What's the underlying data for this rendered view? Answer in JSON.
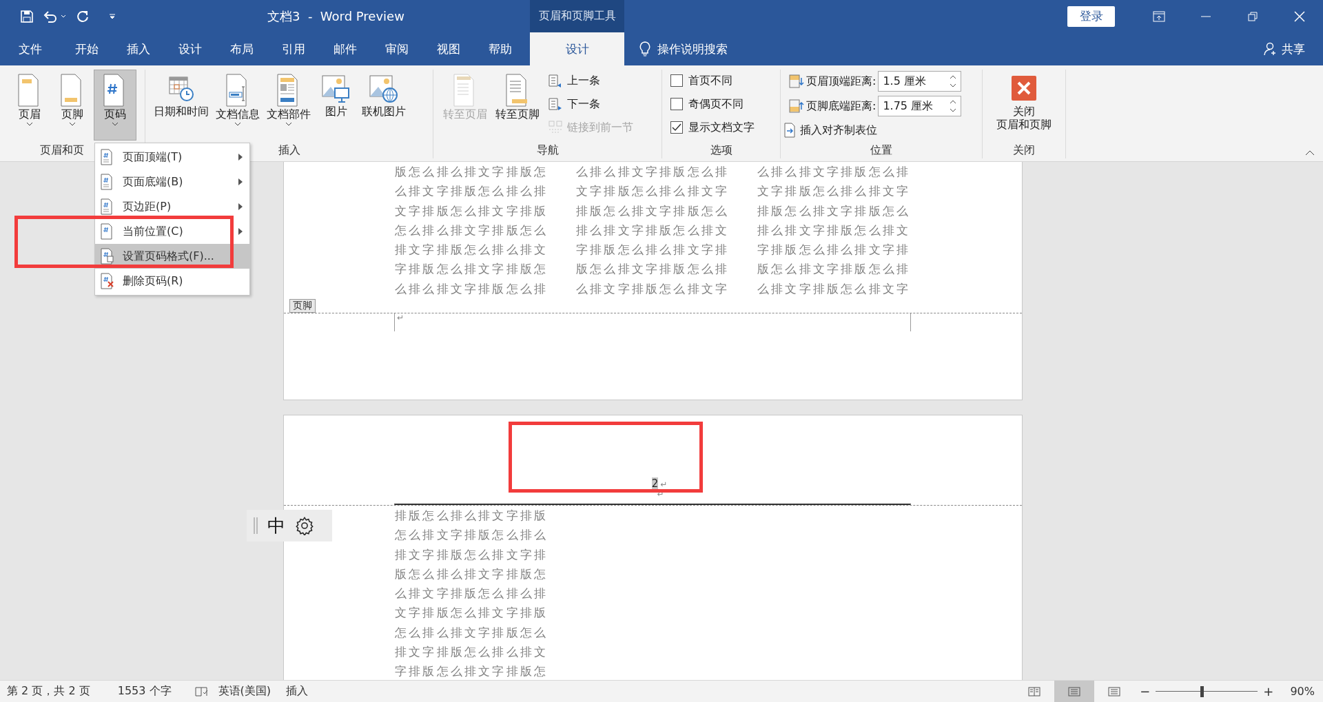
{
  "title_bar": {
    "title": "文档3  -  Word Preview",
    "context_group": "页眉和页脚工具",
    "sign_in": "登录"
  },
  "tabs": [
    {
      "label": "文件",
      "kind": "main",
      "selected": false
    },
    {
      "label": "开始",
      "kind": "main",
      "selected": false
    },
    {
      "label": "插入",
      "kind": "main",
      "selected": false
    },
    {
      "label": "设计",
      "kind": "main",
      "selected": false
    },
    {
      "label": "布局",
      "kind": "main",
      "selected": false
    },
    {
      "label": "引用",
      "kind": "main",
      "selected": false
    },
    {
      "label": "邮件",
      "kind": "main",
      "selected": false
    },
    {
      "label": "审阅",
      "kind": "main",
      "selected": false
    },
    {
      "label": "视图",
      "kind": "main",
      "selected": false
    },
    {
      "label": "帮助",
      "kind": "main",
      "selected": false
    },
    {
      "label": "设计",
      "kind": "context",
      "selected": true
    }
  ],
  "tell_me": "操作说明搜索",
  "share": "共享",
  "ribbon": {
    "groups": [
      {
        "label": "页眉和页",
        "items": [
          {
            "kind": "large",
            "label": "页眉",
            "dropdown": true,
            "pressed": false,
            "disabled": false
          },
          {
            "kind": "large",
            "label": "页脚",
            "dropdown": true,
            "pressed": false,
            "disabled": false
          },
          {
            "kind": "large",
            "label": "页码",
            "dropdown": true,
            "pressed": true,
            "disabled": false
          }
        ]
      },
      {
        "label": "插入",
        "items": [
          {
            "kind": "large",
            "label": "日期和时间",
            "dropdown": false,
            "pressed": false,
            "disabled": false
          },
          {
            "kind": "large",
            "label": "文档信息",
            "dropdown": true,
            "pressed": false,
            "disabled": false
          },
          {
            "kind": "large",
            "label": "文档部件",
            "dropdown": true,
            "pressed": false,
            "disabled": false
          },
          {
            "kind": "large",
            "label": "图片",
            "dropdown": false,
            "pressed": false,
            "disabled": false
          },
          {
            "kind": "large",
            "label": "联机图片",
            "dropdown": false,
            "pressed": false,
            "disabled": false
          }
        ]
      },
      {
        "label": "导航",
        "items": [
          {
            "kind": "large",
            "label": "转至页眉",
            "dropdown": false,
            "pressed": false,
            "disabled": true
          },
          {
            "kind": "large",
            "label": "转至页脚",
            "dropdown": false,
            "pressed": false,
            "disabled": false
          },
          {
            "kind": "small",
            "label": "上一条",
            "disabled": false
          },
          {
            "kind": "small",
            "label": "下一条",
            "disabled": false
          },
          {
            "kind": "small",
            "label": "链接到前一节",
            "disabled": true
          }
        ]
      },
      {
        "label": "选项",
        "items": [
          {
            "kind": "checkbox",
            "label": "首页不同",
            "checked": false
          },
          {
            "kind": "checkbox",
            "label": "奇偶页不同",
            "checked": false
          },
          {
            "kind": "checkbox",
            "label": "显示文档文字",
            "checked": true
          }
        ]
      },
      {
        "label": "位置",
        "items": [
          {
            "kind": "spin",
            "label": "页眉顶端距离:",
            "value": "1.5 厘米"
          },
          {
            "kind": "spin",
            "label": "页脚底端距离:",
            "value": "1.75 厘米"
          },
          {
            "kind": "small",
            "label": "插入对齐制表位",
            "disabled": false
          }
        ]
      },
      {
        "label": "关闭",
        "items": [
          {
            "kind": "close",
            "label_lines": [
              "关闭",
              "页眉和页脚"
            ],
            "dropdown": false,
            "pressed": false,
            "disabled": false
          }
        ]
      }
    ]
  },
  "page_number_menu": {
    "items": [
      {
        "label": "页面顶端(T)",
        "submenu": true,
        "selected": false
      },
      {
        "label": "页面底端(B)",
        "submenu": true,
        "selected": false
      },
      {
        "label": "页边距(P)",
        "submenu": true,
        "selected": false
      },
      {
        "label": "当前位置(C)",
        "submenu": true,
        "selected": false
      },
      {
        "label": "设置页码格式(F)...",
        "submenu": false,
        "selected": true
      },
      {
        "label": "删除页码(R)",
        "submenu": false,
        "selected": false
      }
    ]
  },
  "document": {
    "page1": {
      "columns": [
        [
          "版怎么排么排文字排版怎",
          "么排文字排版怎么排么排",
          "文字排版怎么排文字排版",
          "怎么排么排文字排版怎么",
          "排文字排版怎么排么排文",
          "字排版怎么排文字排版怎",
          "么排么排文字排版怎么排"
        ],
        [
          "么排么排文字排版怎么排",
          "文字排版怎么排么排文字",
          "排版怎么排文字排版怎么",
          "排么排文字排版怎么排文",
          "字排版怎么排么排文字排",
          "版怎么排文字排版怎么排",
          "么排文字排版怎么排文字"
        ],
        [
          "么排么排文字排版怎么排",
          "文字排版怎么排么排文字",
          "排版怎么排文字排版怎么",
          "排么排文字排版怎么排文",
          "字排版怎么排么排文字排",
          "版怎么排文字排版怎么排",
          "么排文字排版怎么排文字"
        ]
      ],
      "footer_tag": "页脚",
      "footer_mark": "↵"
    },
    "page2": {
      "header_text": "2",
      "header_mark": "↵",
      "header_empty_mark": "↵",
      "body_lines": [
        "排版怎么排么排文字排版",
        "怎么排文字排版怎么排么",
        "排文字排版怎么排文字排",
        "版怎么排么排文字排版怎",
        "么排文字排版怎么排么排",
        "文字排版怎么排文字排版",
        "怎么排么排文字排版怎么",
        "排文字排版怎么排么排文",
        "字排版怎么排文字排版怎"
      ]
    }
  },
  "annotations": {
    "menu_item_box": true,
    "page_number_box": true
  },
  "ime_toolbar": {
    "mode": "中"
  },
  "status_bar": {
    "items": [
      {
        "label": "第 2 页，共 2 页"
      },
      {
        "label": "1553 个字"
      },
      {
        "label": "英语(美国)"
      },
      {
        "label": "插入"
      }
    ],
    "views": [
      {
        "selected": false
      },
      {
        "selected": true
      },
      {
        "selected": false
      }
    ],
    "zoom": {
      "minus": "−",
      "plus": "+",
      "level": 0.45,
      "percent": "90%"
    }
  }
}
